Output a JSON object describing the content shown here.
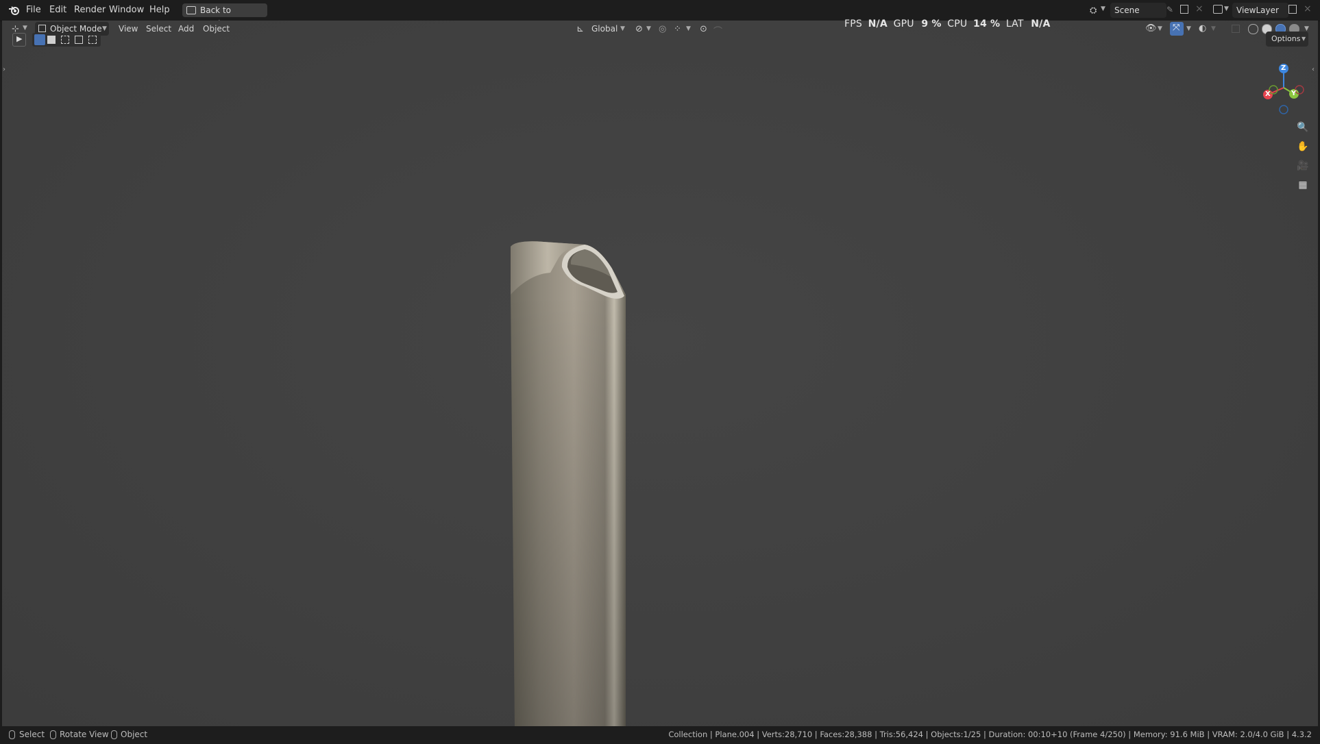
{
  "topbar": {
    "menus": [
      "File",
      "Edit",
      "Render",
      "Window",
      "Help"
    ],
    "back_button": "Back to Previous",
    "scene_label": "Scene",
    "viewlayer_label": "ViewLayer"
  },
  "viewport_header": {
    "mode": "Object Mode",
    "menus": [
      "View",
      "Select",
      "Add",
      "Object"
    ],
    "orientation": "Global",
    "options": "Options"
  },
  "performance": {
    "fps_label": "FPS",
    "fps_value": "N/A",
    "gpu_label": "GPU",
    "gpu_value": "9 %",
    "cpu_label": "CPU",
    "cpu_value": "14 %",
    "lat_label": "LAT",
    "lat_value": "N/A"
  },
  "gizmo": {
    "z": "Z",
    "x": "X",
    "y": "Y"
  },
  "statusbar": {
    "hints": [
      "Select",
      "Rotate View",
      "Object"
    ],
    "info": "Collection | Plane.004 | Verts:28,710 | Faces:28,388 | Tris:56,424 | Objects:1/25 | Duration: 00:10+10 (Frame 4/250) | Memory: 91.6 MiB | VRAM: 2.0/4.0 GiB | 4.3.2"
  },
  "colors": {
    "axis_x": "#e8444f",
    "axis_y": "#8bc53f",
    "axis_z": "#3d87e0",
    "accent": "#4772b3"
  }
}
